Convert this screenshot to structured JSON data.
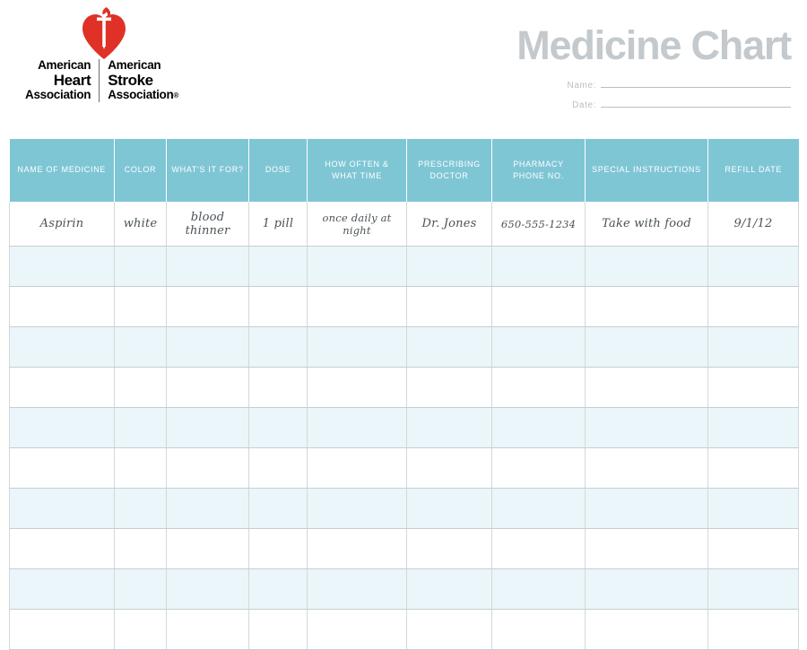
{
  "document": {
    "title": "Medicine Chart"
  },
  "logo": {
    "mark_name": "aha-heart-torch-logo",
    "heart_color": "#e03127",
    "left_column": {
      "line1": "American",
      "line2": "Heart",
      "line3": "Association"
    },
    "right_column": {
      "line1": "American",
      "line2": "Stroke",
      "line3": "Association",
      "registered_mark": "®"
    }
  },
  "form": {
    "name_label": "Name:",
    "date_label": "Date:"
  },
  "table": {
    "headers": [
      "NAME OF MEDICINE",
      "COLOR",
      "WHAT'S IT FOR?",
      "DOSE",
      "HOW OFTEN &\nWHAT TIME",
      "PRESCRIBING\nDOCTOR",
      "PHARMACY\nPHONE NO.",
      "SPECIAL INSTRUCTIONS",
      "REFILL DATE"
    ],
    "headers_flat": {
      "h0": "NAME OF MEDICINE",
      "h1": "COLOR",
      "h2": "WHAT'S IT FOR?",
      "h3": "DOSE",
      "h4a": "HOW OFTEN &",
      "h4b": "WHAT TIME",
      "h5a": "PRESCRIBING",
      "h5b": "DOCTOR",
      "h6a": "PHARMACY",
      "h6b": "PHONE NO.",
      "h7": "SPECIAL INSTRUCTIONS",
      "h8": "REFILL DATE"
    },
    "sample_row": {
      "name_of_medicine": "Aspirin",
      "color": "white",
      "whats_it_for": "blood thinner",
      "dose": "1 pill",
      "how_often_what_time": "once daily at night",
      "prescribing_doctor": "Dr. Jones",
      "pharmacy_phone_no": "650-555-1234",
      "special_instructions": "Take with food",
      "refill_date": "9/1/12"
    },
    "empty_row_count": 10
  },
  "colors": {
    "header_teal": "#7fc6d5",
    "row_tint": "#eaf6f9",
    "row_plain": "#ffffff",
    "title_gray": "#c3c9cc",
    "grid_line": "#d3d8da",
    "handwriting": "#4a5358"
  }
}
